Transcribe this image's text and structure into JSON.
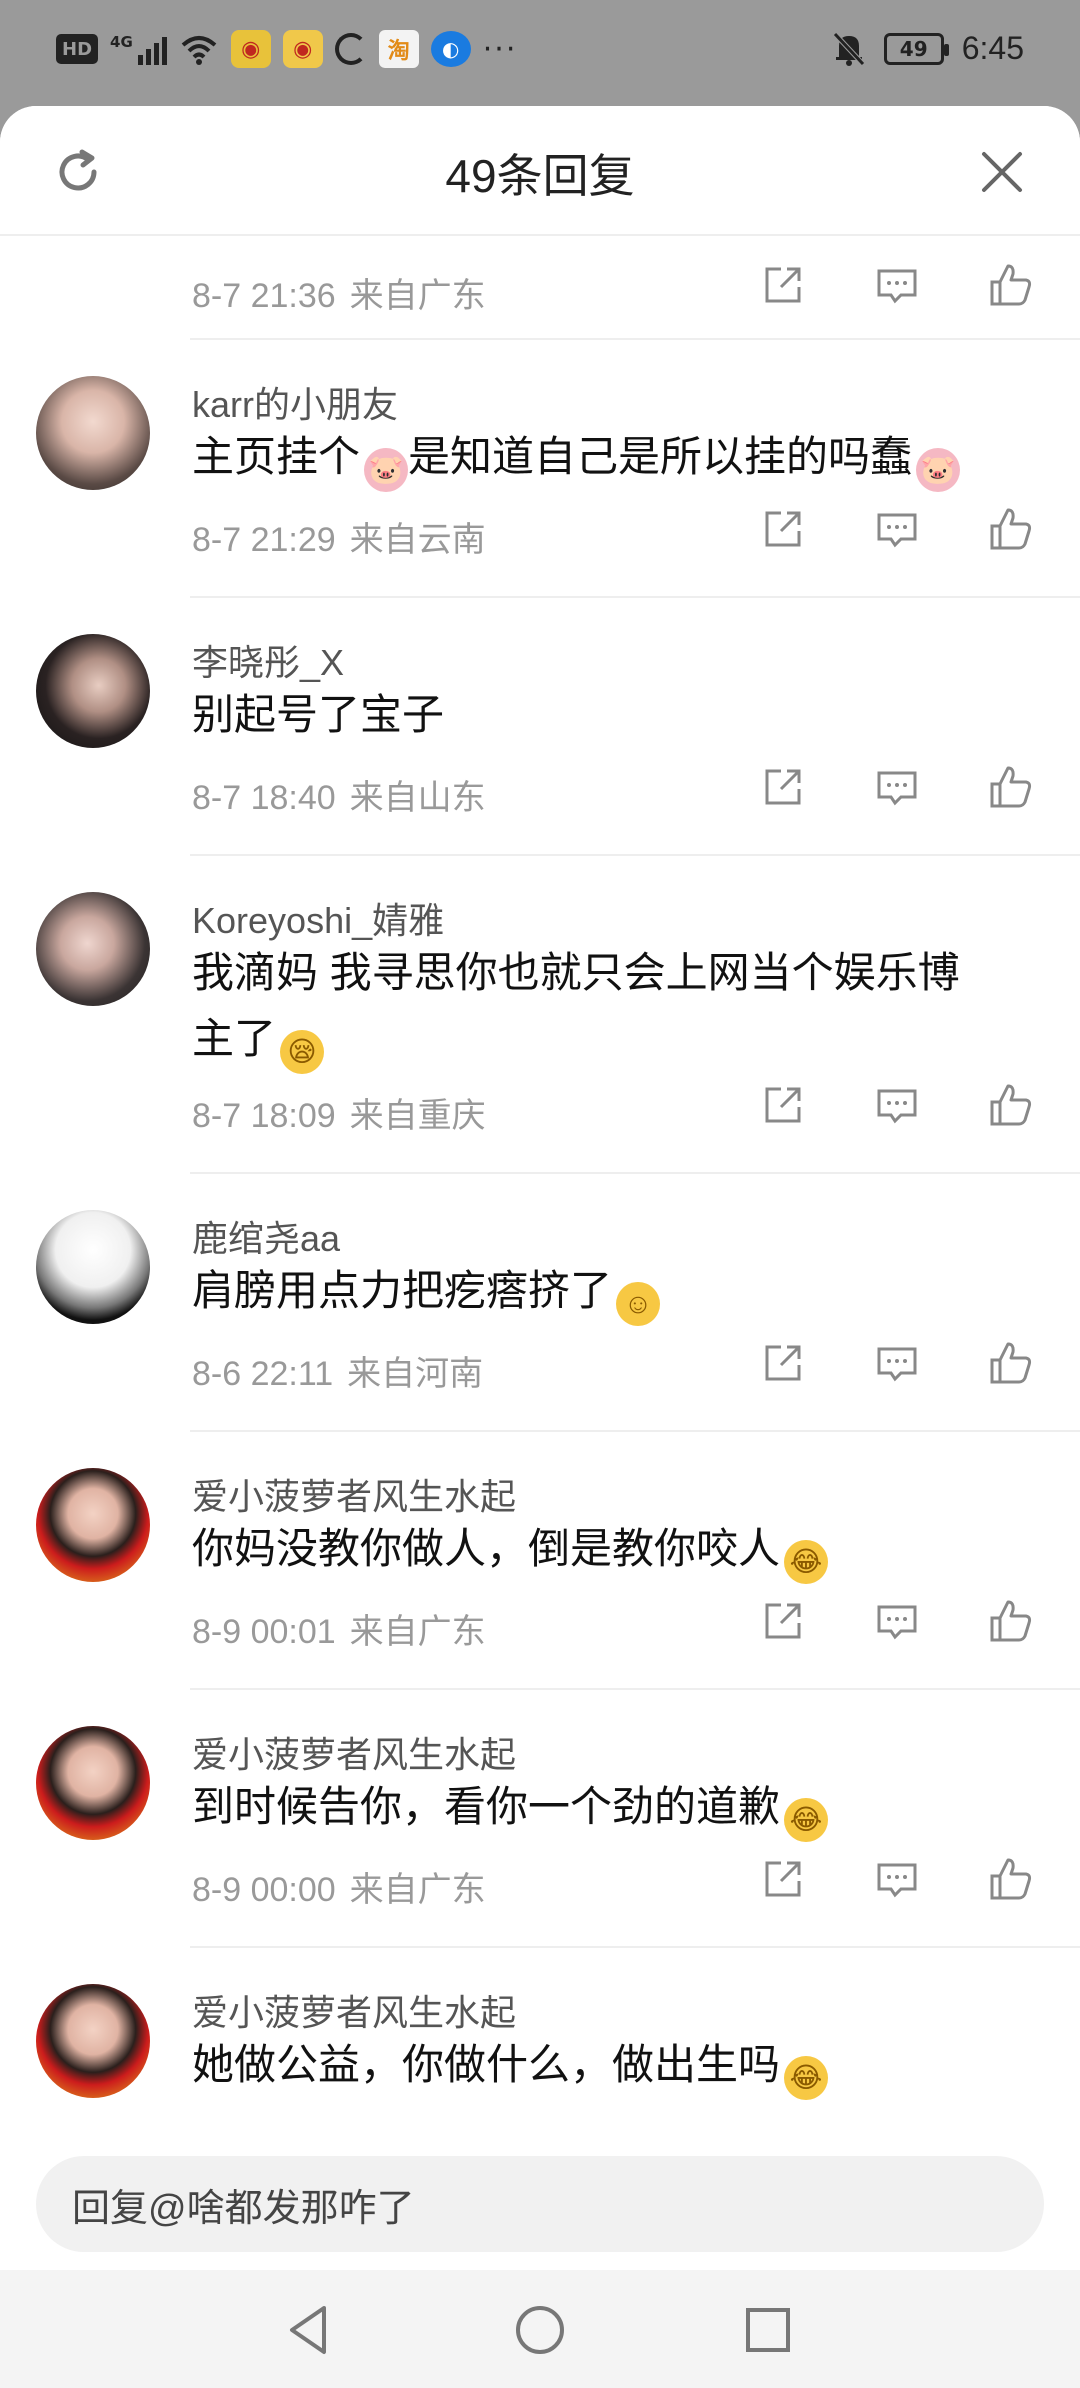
{
  "status_bar": {
    "network_badge": "HD",
    "signal_label": "4G",
    "battery_level": "49",
    "time": "6:45",
    "icons": [
      "hd-icon",
      "signal-icon",
      "wifi-icon",
      "weibo-icon",
      "weibo-icon",
      "loading-icon",
      "taobao-icon",
      "blue-app-icon",
      "more-dots-icon",
      "mute-icon",
      "battery-icon"
    ]
  },
  "sheet": {
    "title": "49条回复",
    "refresh_icon": "refresh-icon",
    "close_icon": "close-icon"
  },
  "comments": [
    {
      "username": "",
      "content": "",
      "date": "8-7 21:36",
      "location": "来自广东",
      "partial": true
    },
    {
      "username": "karr的小朋友",
      "content_parts": [
        "主页挂个",
        "是知道自己是所以挂的吗蠢"
      ],
      "date": "8-7 21:29",
      "location": "来自云南"
    },
    {
      "username": "李晓彤_X",
      "content": "别起号了宝子",
      "date": "8-7 18:40",
      "location": "来自山东"
    },
    {
      "username": "Koreyoshi_婧雅",
      "content_line1": "我滴妈 我寻思你也就只会上网当个娱乐博",
      "content_line2": "主了",
      "date": "8-7 18:09",
      "location": "来自重庆"
    },
    {
      "username": "鹿绾尧aa",
      "content": "肩膀用点力把疙瘩挤了",
      "date": "8-6 22:11",
      "location": "来自河南"
    },
    {
      "username": "爱小菠萝者风生水起",
      "content": "你妈没教你做人，倒是教你咬人",
      "date": "8-9 00:01",
      "location": "来自广东"
    },
    {
      "username": "爱小菠萝者风生水起",
      "content": "到时候告你，看你一个劲的道歉",
      "date": "8-9 00:00",
      "location": "来自广东"
    },
    {
      "username": "爱小菠萝者风生水起",
      "content": "她做公益，你做什么，做出生吗",
      "date": "",
      "location": ""
    }
  ],
  "reply_box": {
    "placeholder": "回复@啥都发那咋了"
  },
  "nav": {
    "back_icon": "back-triangle-icon",
    "home_icon": "home-circle-icon",
    "recents_icon": "recents-square-icon"
  }
}
